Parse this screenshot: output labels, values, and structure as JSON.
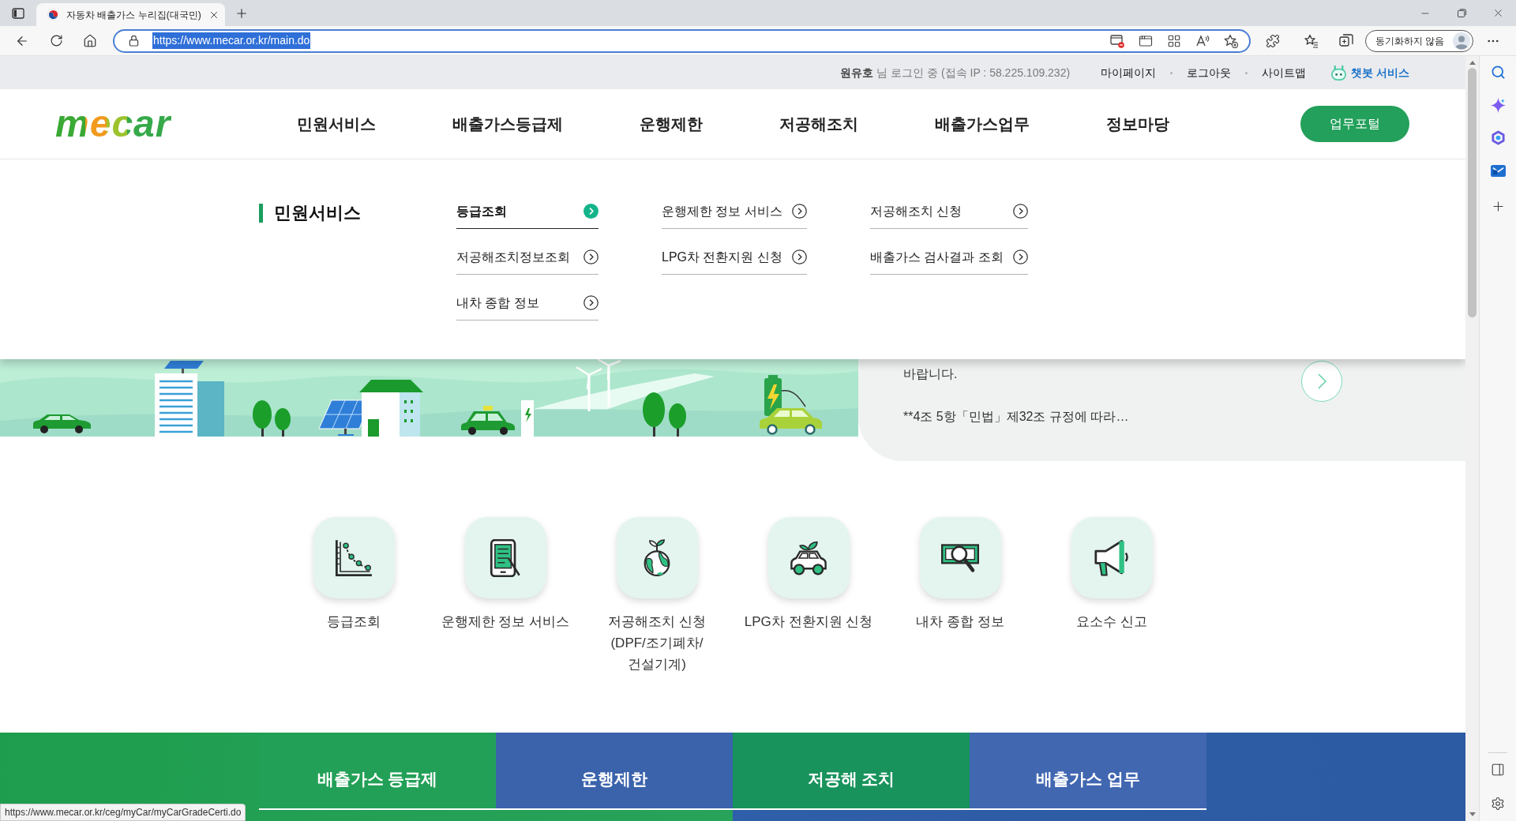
{
  "browser": {
    "tab": {
      "title": "자동차 배출가스 누리집(대국민)",
      "selected": true
    },
    "url": "https://www.mecar.or.kr/main.do",
    "url_selected": true,
    "profile_button": "동기화하지 않음"
  },
  "utility_bar": {
    "login_status": "**원유호** 님 로그인 중 (접속 IP : 58.225.109.232)",
    "links": [
      {
        "label": "마이페이지",
        "kind": "link"
      },
      {
        "label": "로그아웃",
        "kind": "link"
      },
      {
        "label": "사이트맵",
        "kind": "link"
      },
      {
        "label": "챗봇 서비스",
        "kind": "chatbot"
      }
    ]
  },
  "header": {
    "logo": "mecar",
    "nav": [
      "민원서비스",
      "배출가스등급제",
      "운행제한",
      "저공해조치",
      "배출가스업무",
      "정보마당"
    ],
    "portal_button": "업무포털"
  },
  "mega_menu": {
    "title": "민원서비스",
    "columns": [
      {
        "items": [
          {
            "label": "등급조회",
            "selected": true
          },
          {
            "label": "저공해조치정보조회",
            "selected": false
          },
          {
            "label": "내차 종합 정보",
            "selected": false
          }
        ]
      },
      {
        "items": [
          {
            "label": "운행제한 정보 서비스",
            "selected": false
          },
          {
            "label": "LPG차 전환지원 신청",
            "selected": false
          }
        ]
      },
      {
        "items": [
          {
            "label": "저공해조치 신청",
            "selected": false
          },
          {
            "label": "배출가스 검사결과 조회",
            "selected": false
          }
        ]
      }
    ]
  },
  "notice": {
    "paragraphs": [
      "바랍니다.",
      "**4조 5항「민법」제32조 규정에 따라…"
    ]
  },
  "services": [
    {
      "label": "등급조회",
      "kind": "chart"
    },
    {
      "label": "운행제한 정보 서비스",
      "kind": "tablet"
    },
    {
      "label": "저공해조치 신청\n(DPF/조기폐차/\n건설기계)",
      "kind": "globe"
    },
    {
      "label": "LPG차 전환지원 신청",
      "kind": "car"
    },
    {
      "label": "내차 종합 정보",
      "kind": "inspect"
    },
    {
      "label": "요소수 신고",
      "kind": "megaphone"
    }
  ],
  "bottom_tabs": [
    {
      "label": "배출가스 등급제",
      "color": "#23a057"
    },
    {
      "label": "운행제한",
      "color": "#3b63ac"
    },
    {
      "label": "저공해 조치",
      "color": "#18935c"
    },
    {
      "label": "배출가스 업무",
      "color": "#4167b1"
    }
  ],
  "status_url": "https://www.mecar.or.kr/ceg/myCar/myCarGradeCerti.do"
}
